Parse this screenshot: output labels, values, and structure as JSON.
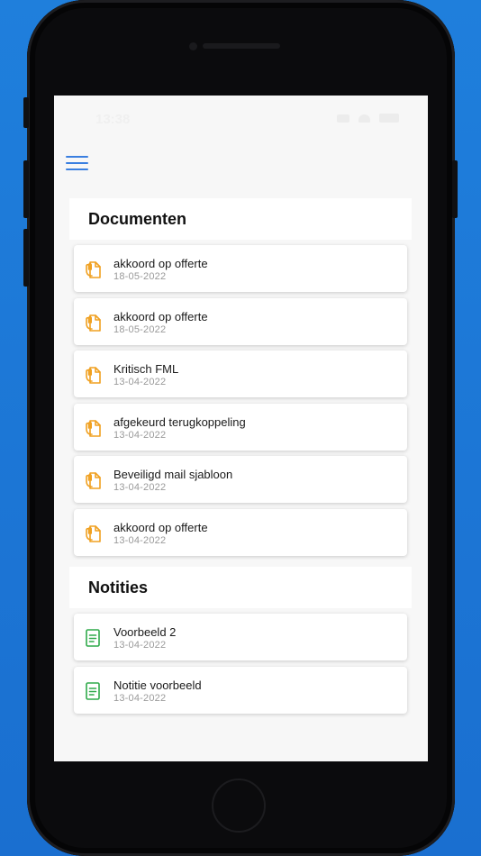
{
  "status_bar": {
    "time": "13:38",
    "icons": [
      "signal-icon",
      "wifi-icon",
      "battery-icon"
    ]
  },
  "header": {
    "menu_icon": "hamburger-menu-icon"
  },
  "documents": {
    "title": "Documenten",
    "icon": "document-hand-icon",
    "color": "#f0a020",
    "items": [
      {
        "name": "akkoord op offerte",
        "date": "18-05-2022"
      },
      {
        "name": "akkoord op offerte",
        "date": "18-05-2022"
      },
      {
        "name": "Kritisch FML",
        "date": "13-04-2022"
      },
      {
        "name": "afgekeurd terugkoppeling",
        "date": "13-04-2022"
      },
      {
        "name": "Beveiligd mail sjabloon",
        "date": "13-04-2022"
      },
      {
        "name": "akkoord op offerte",
        "date": "13-04-2022"
      }
    ]
  },
  "notes": {
    "title": "Notities",
    "icon": "note-icon",
    "color": "#2faa4a",
    "items": [
      {
        "name": "Voorbeeld 2",
        "date": "13-04-2022"
      },
      {
        "name": "Notitie voorbeeld",
        "date": "13-04-2022"
      }
    ]
  }
}
